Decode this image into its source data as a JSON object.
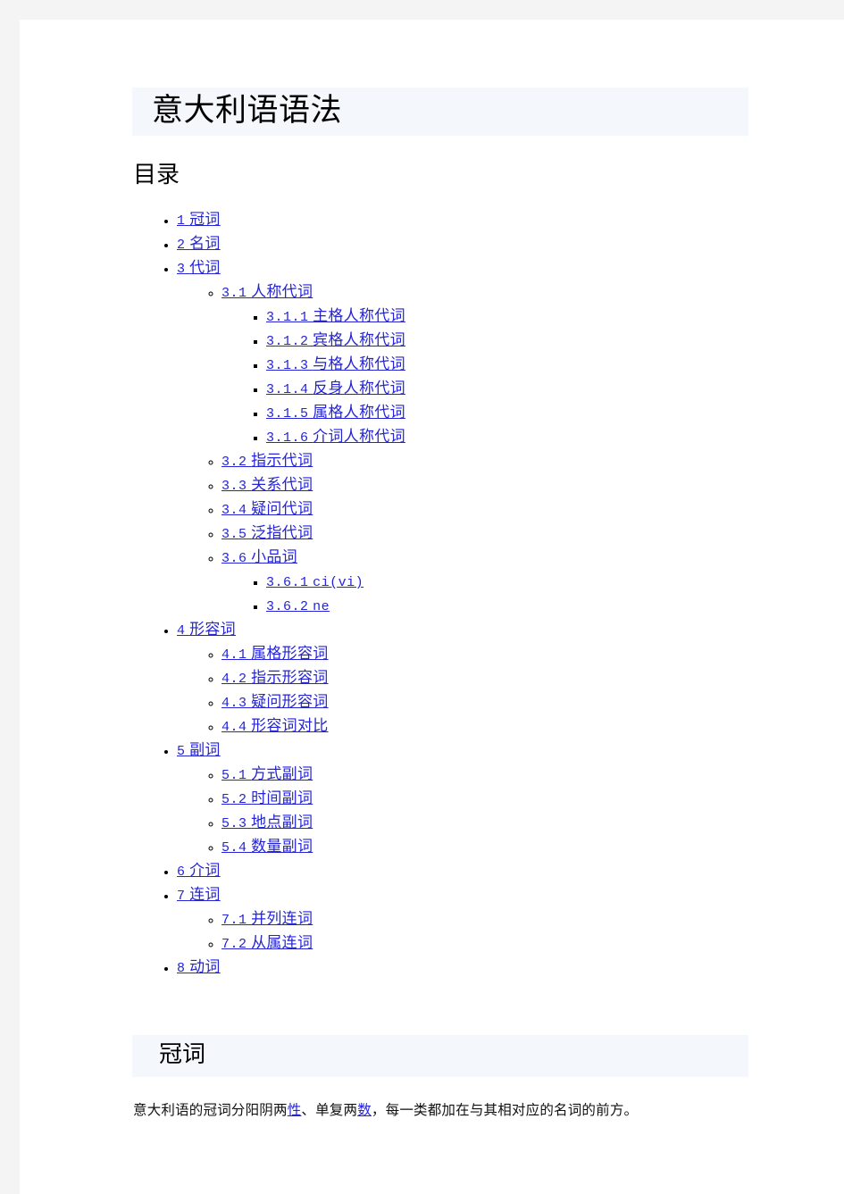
{
  "colors": {
    "page_background": "#ffffff",
    "outer_margin": "#f4f4f4",
    "heading_band": "#f4f8fd",
    "link": "#2525d6",
    "body_text": "#111111"
  },
  "page": {
    "title": "意大利语语法"
  },
  "toc": {
    "heading": "目录",
    "items": [
      {
        "num": "1",
        "label": "冠词"
      },
      {
        "num": "2",
        "label": "名词"
      },
      {
        "num": "3",
        "label": "代词",
        "children": [
          {
            "num": "3.1",
            "label": "人称代词",
            "children": [
              {
                "num": "3.1.1",
                "label": "主格人称代词"
              },
              {
                "num": "3.1.2",
                "label": "宾格人称代词"
              },
              {
                "num": "3.1.3",
                "label": "与格人称代词"
              },
              {
                "num": "3.1.4",
                "label": "反身人称代词"
              },
              {
                "num": "3.1.5",
                "label": "属格人称代词"
              },
              {
                "num": "3.1.6",
                "label": "介词人称代词"
              }
            ]
          },
          {
            "num": "3.2",
            "label": "指示代词"
          },
          {
            "num": "3.3",
            "label": "关系代词"
          },
          {
            "num": "3.4",
            "label": "疑问代词"
          },
          {
            "num": "3.5",
            "label": "泛指代词"
          },
          {
            "num": "3.6",
            "label": "小品词",
            "children": [
              {
                "num": "3.6.1",
                "label": "ci(vi)",
                "mono": true
              },
              {
                "num": "3.6.2",
                "label": "ne",
                "mono": true
              }
            ]
          }
        ]
      },
      {
        "num": "4",
        "label": "形容词",
        "children": [
          {
            "num": "4.1",
            "label": "属格形容词"
          },
          {
            "num": "4.2",
            "label": "指示形容词"
          },
          {
            "num": "4.3",
            "label": "疑问形容词"
          },
          {
            "num": "4.4",
            "label": "形容词对比"
          }
        ]
      },
      {
        "num": "5",
        "label": "副词",
        "children": [
          {
            "num": "5.1",
            "label": "方式副词"
          },
          {
            "num": "5.2",
            "label": "时间副词"
          },
          {
            "num": "5.3",
            "label": "地点副词"
          },
          {
            "num": "5.4",
            "label": "数量副词"
          }
        ]
      },
      {
        "num": "6",
        "label": "介词"
      },
      {
        "num": "7",
        "label": "连词",
        "children": [
          {
            "num": "7.1",
            "label": "并列连词"
          },
          {
            "num": "7.2",
            "label": "从属连词"
          }
        ]
      },
      {
        "num": "8",
        "label": "动词"
      }
    ]
  },
  "section": {
    "heading": "冠词",
    "paragraph": {
      "parts": [
        {
          "type": "text",
          "text": "意大利语的冠词分阳阴两"
        },
        {
          "type": "link",
          "text": "性"
        },
        {
          "type": "text",
          "text": "、单复两"
        },
        {
          "type": "link",
          "text": "数"
        },
        {
          "type": "text",
          "text": "，每一类都加在与其相对应的名词的前方。"
        }
      ]
    }
  }
}
